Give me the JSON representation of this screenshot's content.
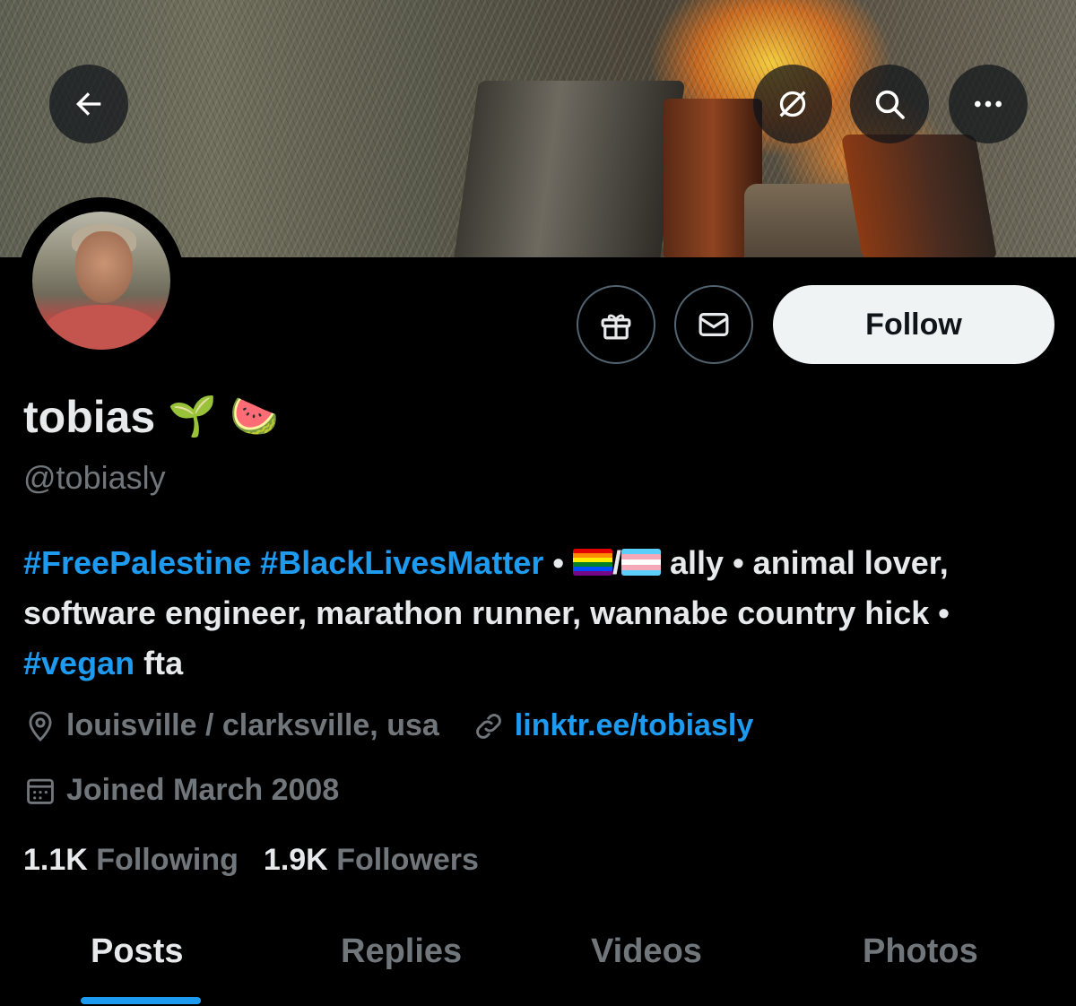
{
  "header": {
    "back_icon": "arrow-left-icon",
    "actions": [
      {
        "name": "translate-off-icon"
      },
      {
        "name": "search-icon"
      },
      {
        "name": "more-icon"
      }
    ]
  },
  "profile": {
    "display_name": "tobias",
    "name_emojis": [
      "🌱",
      "🍉"
    ],
    "handle": "@tobiasly",
    "follow_label": "Follow",
    "gift_icon": "gift-icon",
    "message_icon": "envelope-icon"
  },
  "bio": {
    "tag1": "#FreePalestine",
    "tag2": "#BlackLivesMatter",
    "sep1": "•",
    "slash": "/",
    "text1": "ally • animal lover, software engineer, marathon runner, wannabe country hick •",
    "tag3": "#vegan",
    "text2": "fta"
  },
  "meta": {
    "location": "louisville / clarksville, usa",
    "website": "linktr.ee/tobiasly",
    "joined": "Joined March 2008"
  },
  "stats": {
    "following_count": "1.1K",
    "following_label": "Following",
    "followers_count": "1.9K",
    "followers_label": "Followers"
  },
  "tabs": [
    "Posts",
    "Replies",
    "Videos",
    "Photos"
  ],
  "colors": {
    "accent": "#1d9bf0",
    "muted": "#71767b",
    "text": "#e7e9ea",
    "background": "#000000"
  }
}
